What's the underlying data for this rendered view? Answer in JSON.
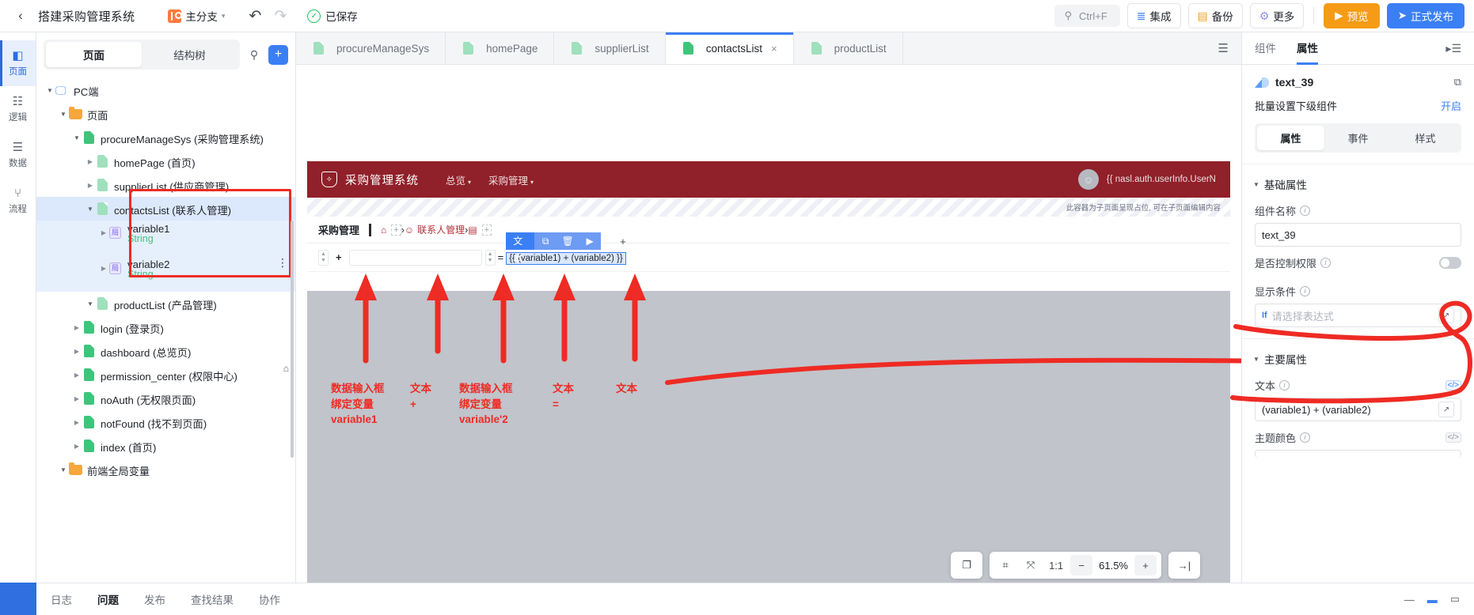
{
  "topbar": {
    "back_icon": "chevron-left-icon",
    "title": "搭建采购管理系统",
    "branch": {
      "label": "主分支",
      "caret": "⌄"
    },
    "undo": "↶",
    "redo": "↷",
    "saved": {
      "check": "✓",
      "label": "已保存"
    },
    "search": {
      "icon": "🔍",
      "shortcut": "Ctrl+F"
    },
    "buttons": [
      {
        "icon": "≣",
        "label": "集成",
        "name": "integration"
      },
      {
        "icon": "▤",
        "label": "备份",
        "name": "backup"
      },
      {
        "icon": "⚙",
        "label": "更多",
        "name": "more"
      }
    ],
    "preview": {
      "icon": "▶",
      "label": "预览"
    },
    "publish": {
      "icon": "➤",
      "label": "正式发布"
    },
    "accent_blue": "#3b7ff5",
    "accent_orange": "#f59b16"
  },
  "rail": {
    "items": [
      {
        "glyph": "◧",
        "label": "页面",
        "active": true
      },
      {
        "glyph": "☷",
        "label": "逻辑",
        "active": false
      },
      {
        "glyph": "☰",
        "label": "数据",
        "active": false
      },
      {
        "glyph": "⑂",
        "label": "流程",
        "active": false
      }
    ]
  },
  "leftpanel": {
    "tabs": [
      {
        "label": "页面",
        "active": true
      },
      {
        "label": "结构树",
        "active": false
      }
    ],
    "search_icon": "search-icon",
    "add_icon": "+",
    "tree": [
      {
        "indent": 0,
        "arrow": "open",
        "icon": "pc",
        "label": "PC端"
      },
      {
        "indent": 1,
        "arrow": "open",
        "icon": "folder",
        "label": "页面"
      },
      {
        "indent": 2,
        "arrow": "open",
        "icon": "page",
        "label": "procureManageSys (采购管理系统)"
      },
      {
        "indent": 3,
        "arrow": "closed",
        "icon": "page-light",
        "label": "homePage (首页)"
      },
      {
        "indent": 3,
        "arrow": "closed",
        "icon": "page-light",
        "label": "supplierList (供应商管理)"
      },
      {
        "indent": 3,
        "arrow": "open",
        "icon": "page-light",
        "label": "contactsList (联系人管理)",
        "selected": true
      },
      {
        "indent": 4,
        "arrow": "closed",
        "icon": "var",
        "label": "variable1",
        "sub": "String",
        "selected2": true
      },
      {
        "indent": 4,
        "arrow": "closed",
        "icon": "var",
        "label": "variable2",
        "sub": "String",
        "selected2": true,
        "menu": "⋮"
      },
      {
        "indent": 3,
        "arrow": "open",
        "icon": "page-light",
        "label": "productList (产品管理)"
      },
      {
        "indent": 2,
        "arrow": "closed",
        "icon": "page",
        "label": "login (登录页)"
      },
      {
        "indent": 2,
        "arrow": "closed",
        "icon": "page",
        "label": "dashboard (总览页)"
      },
      {
        "indent": 2,
        "arrow": "closed",
        "icon": "page",
        "label": "permission_center (权限中心)",
        "home": "⌂"
      },
      {
        "indent": 2,
        "arrow": "closed",
        "icon": "page",
        "label": "noAuth (无权限页面)"
      },
      {
        "indent": 2,
        "arrow": "closed",
        "icon": "page",
        "label": "notFound (找不到页面)"
      },
      {
        "indent": 2,
        "arrow": "closed",
        "icon": "page",
        "label": "index (首页)"
      },
      {
        "indent": 1,
        "arrow": "open",
        "icon": "folder",
        "label": "前端全局变量"
      }
    ]
  },
  "filetabs": {
    "items": [
      {
        "label": "procureManageSys",
        "active": false
      },
      {
        "label": "homePage",
        "active": false
      },
      {
        "label": "supplierList",
        "active": false
      },
      {
        "label": "contactsList",
        "active": true,
        "close": "×"
      },
      {
        "label": "productList",
        "active": false
      }
    ],
    "list_icon": "list-icon"
  },
  "canvas": {
    "app_header": {
      "logo_icon": "shield-icon",
      "name": "采购管理系统",
      "nav": [
        {
          "label": "总览"
        },
        {
          "label": "采购管理"
        }
      ],
      "avatar_icon": "user-avatar-icon",
      "user_expr": "{{ nasl.auth.userInfo.UserN",
      "bg": "#90202a"
    },
    "hatch_note": "此容器为子页面呈现占位, 可在子页面编辑内容",
    "breadcrumb": {
      "title": "采购管理",
      "home_icon": "⌂",
      "items": [
        {
          "icon": "☺",
          "label": "联系人管理"
        },
        {
          "icon": "▤",
          "label": ""
        }
      ],
      "sep": "›",
      "plus": "+"
    },
    "selection": {
      "chip_label": "文本",
      "tools": [
        "⧉",
        "🗑",
        "▶"
      ],
      "add": "+",
      "expression": "{{ (variable1) + (variable2) }}",
      "equals": "="
    },
    "annotations": [
      {
        "text": "数据输入框\n绑定变量\nvariable1"
      },
      {
        "text": "文本\n+"
      },
      {
        "text": "数据输入框\n绑定变量\nvariable'2"
      },
      {
        "text": "文本\n="
      },
      {
        "text": "文本"
      }
    ],
    "zoomtools": {
      "page_icon": "❐",
      "select_icon": "⌗",
      "fit_icon": "⤧",
      "ratio": "1:1",
      "minus": "−",
      "percent": "61.5%",
      "plus": "+",
      "panel_icon": "→|"
    }
  },
  "rightpanel": {
    "tabs": [
      {
        "label": "组件",
        "active": false
      },
      {
        "label": "属性",
        "active": true
      }
    ],
    "collapse_icon": "▸☰",
    "component": {
      "icon": "text-component-icon",
      "name": "text_39",
      "copy_icon": "⧉"
    },
    "batch": {
      "label": "批量设置下级组件",
      "link": "开启"
    },
    "segs": [
      {
        "label": "属性",
        "active": true
      },
      {
        "label": "事件",
        "active": false
      },
      {
        "label": "样式",
        "active": false
      }
    ],
    "sections": [
      {
        "title": "基础属性",
        "fields": [
          {
            "label": "组件名称",
            "type": "text",
            "value": "text_39"
          },
          {
            "label": "是否控制权限",
            "type": "toggle",
            "value": "off"
          },
          {
            "label": "显示条件",
            "type": "expr",
            "prefix": "If",
            "placeholder": "请选择表达式"
          }
        ]
      },
      {
        "title": "主要属性",
        "fields": [
          {
            "label": "文本",
            "type": "expr-value",
            "value": "(variable1) + (variable2)",
            "code_icon": "</>"
          },
          {
            "label": "主题颜色",
            "type": "color",
            "code_icon": "</>"
          }
        ]
      }
    ]
  },
  "bottombar": {
    "tabs": [
      {
        "label": "日志",
        "active": false
      },
      {
        "label": "问题",
        "active": true
      },
      {
        "label": "发布",
        "active": false
      },
      {
        "label": "查找结果",
        "active": false
      },
      {
        "label": "协作",
        "active": false
      }
    ],
    "window_controls": [
      "—",
      "▬",
      "▭"
    ]
  }
}
